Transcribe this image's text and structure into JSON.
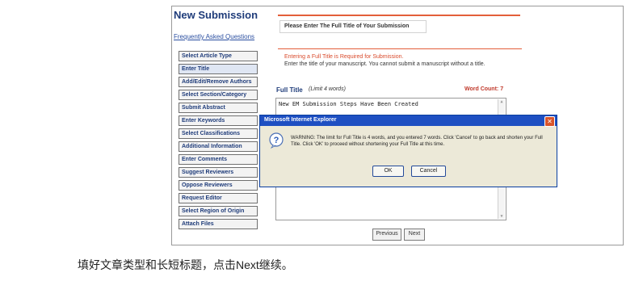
{
  "page": {
    "title": "New Submission",
    "faq_link": "Frequently Asked Questions"
  },
  "steps": [
    {
      "label": "Select Article Type",
      "checked": true
    },
    {
      "label": "Enter Title",
      "current": true
    },
    {
      "label": "Add/Edit/Remove Authors"
    },
    {
      "label": "Select Section/Category"
    },
    {
      "label": "Submit Abstract"
    },
    {
      "label": "Enter Keywords"
    },
    {
      "label": "Select Classifications"
    },
    {
      "label": "Additional Information"
    },
    {
      "label": "Enter Comments"
    },
    {
      "label": "Suggest Reviewers",
      "checked": true
    },
    {
      "label": "Oppose Reviewers",
      "checked": true
    },
    {
      "label": "Request Editor"
    },
    {
      "label": "Select Region of Origin"
    },
    {
      "label": "Attach Files"
    }
  ],
  "panel": {
    "heading": "Please Enter The Full Title of Your Submission",
    "instruction_required": "Entering a Full Title is Required for Submission.",
    "instruction_detail": "Enter the title of your manuscript. You cannot submit a manuscript without a title.",
    "field_label": "Full Title",
    "field_hint": "(Limit 4 words)",
    "word_count": "Word Count: 7",
    "title_value": "New EM Submission Steps Have Been Created",
    "prev_label": "Previous",
    "next_label": "Next"
  },
  "dialog": {
    "title": "Microsoft Internet Explorer",
    "message": "WARNING: The limit for Full Title is 4 words, and you entered 7 words. Click 'Cancel' to go back and shorten your Full Title. Click 'OK' to proceed without shortening your Full Title at this time.",
    "ok_label": "OK",
    "cancel_label": "Cancel",
    "icon": "question-icon"
  },
  "caption": "填好文章类型和长短标题，点击Next继续。",
  "colors": {
    "accent_red": "#e35f3a",
    "title_blue": "#1f3c7a",
    "dialog_titlebar": "#1e4fc2",
    "word_count_red": "#c0392b"
  }
}
